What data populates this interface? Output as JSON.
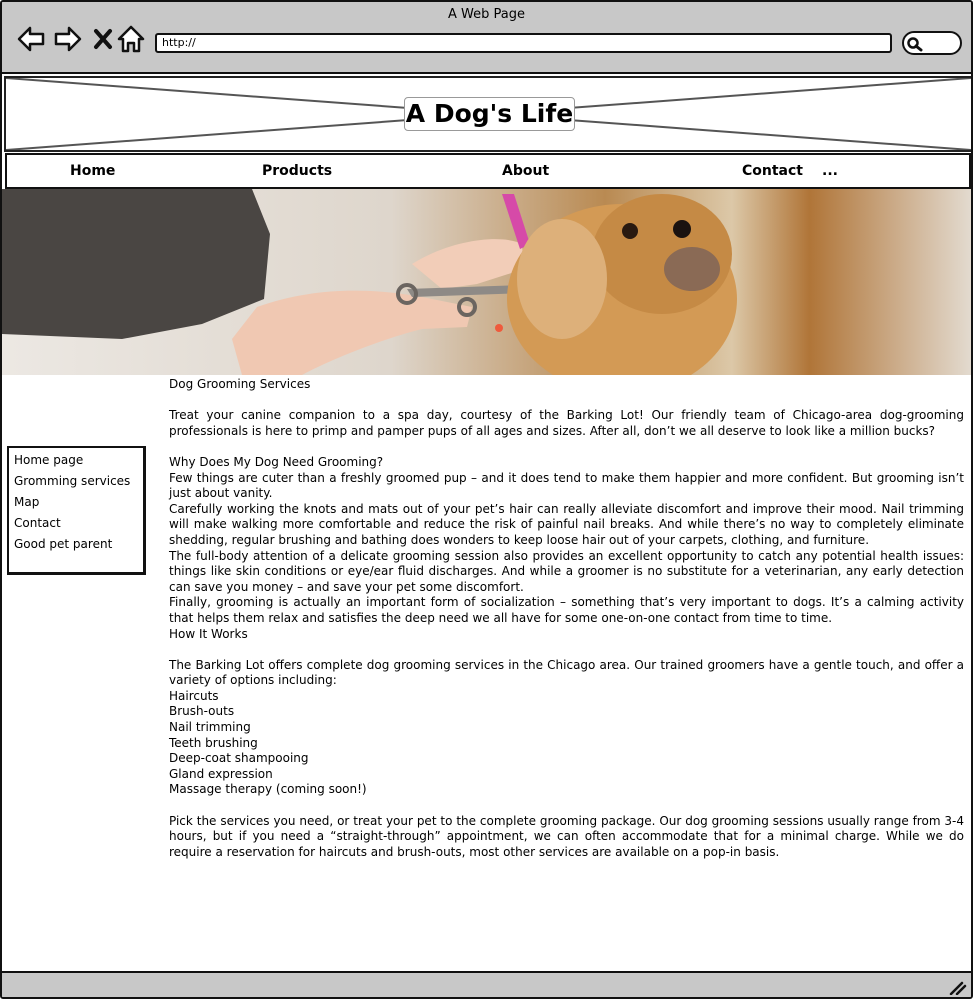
{
  "window": {
    "title": "A Web Page"
  },
  "toolbar": {
    "back_icon": "back-arrow-icon",
    "forward_icon": "forward-arrow-icon",
    "stop_icon": "close-icon",
    "home_icon": "home-icon",
    "url": "http://",
    "search_icon": "search-icon"
  },
  "header": {
    "site_title": "A Dog's Life"
  },
  "topnav": {
    "items": [
      "Home",
      "Products",
      "About",
      "Contact",
      "..."
    ]
  },
  "hero": {
    "image": "Groomer trimming a fluffy golden dog with scissors"
  },
  "sidebar": {
    "items": [
      "Home page",
      "Gromming services",
      "Map",
      "Contact",
      "Good pet parent"
    ]
  },
  "content": {
    "title": "Dog Grooming Services",
    "intro": "Treat your canine companion to a spa day, courtesy of the Barking Lot! Our friendly team of Chicago-area dog-grooming professionals is here to primp and pamper pups of all ages and sizes. After all, don’t we all deserve to look like a million bucks?",
    "why_heading": "Why Does My Dog Need Grooming?",
    "why_paragraphs": [
      "Few things are cuter than a freshly groomed pup – and it does tend to make them happier and more confident. But grooming isn’t just about vanity.",
      "Carefully working the knots and mats out of your pet’s hair can really alleviate discomfort and improve their mood. Nail trimming will make walking more comfortable and reduce the risk of painful nail breaks. And while there’s no way to completely eliminate shedding, regular brushing and bathing does wonders to keep loose hair out of your carpets, clothing, and furniture.",
      "The full-body attention of a delicate grooming session also provides an excellent opportunity to catch any potential health issues: things like skin conditions or eye/ear fluid discharges. And while a groomer is no substitute for a veterinarian, any early detection can save you money – and save your pet some discomfort.",
      "Finally, grooming is actually an important form of socialization – something that’s very important to dogs. It’s a calming activity that helps them relax and satisfies the deep need we all have for some one-on-one contact from time to time."
    ],
    "how_heading": "How It Works",
    "how_intro": "The Barking Lot offers complete dog grooming services in the Chicago area. Our trained groomers have a gentle touch, and offer a variety of options including:",
    "services": [
      "Haircuts",
      "Brush-outs",
      "Nail trimming",
      "Teeth brushing",
      "Deep-coat shampooing",
      "Gland expression",
      "Massage therapy (coming soon!)"
    ],
    "closing": "Pick the services you need, or treat your pet to the complete grooming package. Our dog grooming sessions usually range from 3-4 hours, but if you need a “straight-through” appointment, we can often accommodate that for a minimal charge. While we do require a reservation for haircuts and brush-outs, most other services are available on a pop-in basis."
  },
  "statusbar": {
    "resize_icon": "resize-grip-icon"
  }
}
